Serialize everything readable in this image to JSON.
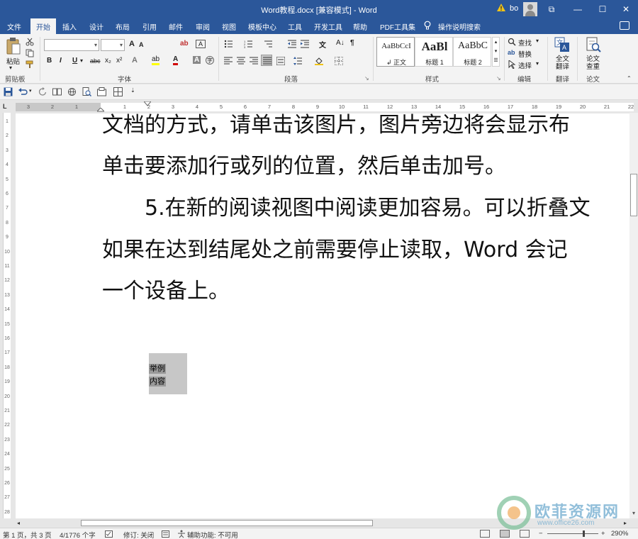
{
  "window": {
    "title": "Word教程.docx [兼容模式]  -  Word",
    "user_name": "bo",
    "controls": {
      "ribbon_options": "⧉",
      "minimize": "—",
      "maximize": "☐",
      "close": "✕"
    }
  },
  "tabs": [
    "文件",
    "开始",
    "插入",
    "设计",
    "布局",
    "引用",
    "邮件",
    "审阅",
    "视图",
    "模板中心",
    "工具",
    "开发工具",
    "帮助",
    "PDF工具集"
  ],
  "active_tab": "开始",
  "tell_me": "操作说明搜索",
  "ribbon": {
    "clipboard": {
      "paste": "粘贴",
      "group": "剪贴板"
    },
    "font": {
      "group": "字体",
      "font_name": "",
      "font_size": "",
      "buttons": [
        "B",
        "I",
        "U",
        "abc",
        "x₂",
        "x²",
        "A"
      ],
      "grow": "A",
      "shrink": "A",
      "highlight": "ab",
      "color": "A"
    },
    "paragraph": {
      "group": "段落"
    },
    "styles": {
      "group": "样式",
      "items": [
        {
          "preview": "AaBbCcI",
          "name": "↲ 正文"
        },
        {
          "preview": "AaBl",
          "name": "标题 1"
        },
        {
          "preview": "AaBbC",
          "name": "标题 2"
        }
      ]
    },
    "editing": {
      "group": "编辑",
      "find": "查找",
      "replace": "替换",
      "select": "选择"
    },
    "translate": {
      "group": "翻译",
      "label_line1": "全文",
      "label_line2": "翻译"
    },
    "paper": {
      "group": "论文",
      "label_line1": "论文",
      "label_line2": "查重"
    }
  },
  "ruler": {
    "horizontal_left": [
      "3",
      "2",
      "1"
    ],
    "horizontal_right": [
      "1",
      "2",
      "3",
      "4",
      "5",
      "6",
      "7",
      "8",
      "9",
      "10",
      "11",
      "12",
      "13",
      "14",
      "15",
      "16",
      "17",
      "18",
      "19",
      "20",
      "21",
      "22"
    ],
    "vertical": [
      "1",
      "2",
      "3",
      "4",
      "5",
      "6",
      "7",
      "8",
      "9",
      "10",
      "11",
      "12",
      "13",
      "14",
      "15",
      "16",
      "17",
      "18",
      "19",
      "20",
      "21",
      "22",
      "23",
      "24",
      "25",
      "26",
      "27",
      "28"
    ]
  },
  "document": {
    "lines": [
      "文档的方式，请单击该图片，图片旁边将会显示布",
      "单击要添加行或列的位置，然后单击加号。",
      "　　5.在新的阅读视图中阅读更加容易。可以折叠文",
      "如果在达到结尾处之前需要停止读取，Word 会记",
      "一个设备上。"
    ],
    "note_lines": [
      "举例",
      "内容"
    ]
  },
  "status": {
    "page": "第 1 页，共 3 页",
    "words": "4/1776 个字",
    "track": "修订: 关闭",
    "accessibility": "辅助功能: 不可用",
    "zoom": "290%"
  },
  "watermark": {
    "text": "欧菲资源网",
    "url": "www.office26.com"
  }
}
